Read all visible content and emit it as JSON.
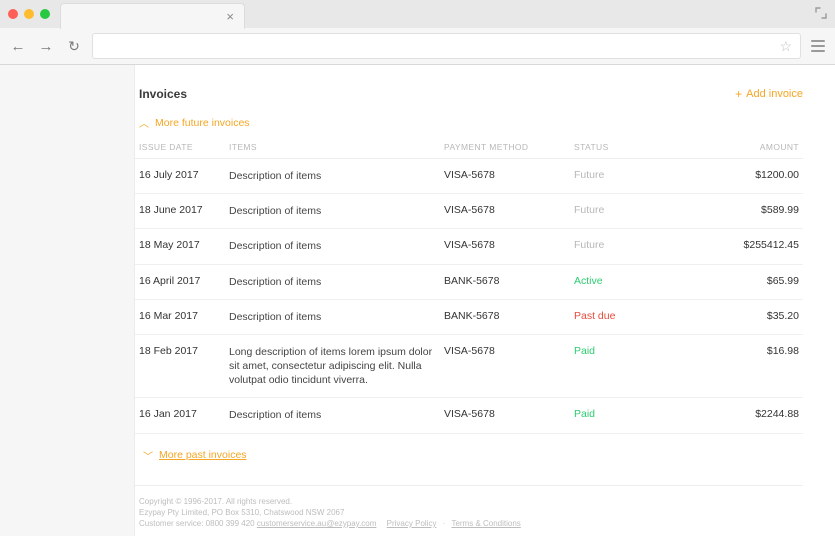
{
  "header": {
    "title": "Invoices",
    "add_label": "Add invoice",
    "more_future_label": "More future invoices",
    "more_past_label": "More past invoices"
  },
  "columns": {
    "issue_date": "ISSUE DATE",
    "items": "ITEMS",
    "payment_method": "PAYMENT METHOD",
    "status": "STATUS",
    "amount": "AMOUNT"
  },
  "rows": [
    {
      "date": "16 July 2017",
      "items": "Description of items",
      "payment": "VISA-5678",
      "status": "Future",
      "status_key": "future",
      "amount": "$1200.00"
    },
    {
      "date": "18 June 2017",
      "items": "Description of items",
      "payment": "VISA-5678",
      "status": "Future",
      "status_key": "future",
      "amount": "$589.99"
    },
    {
      "date": "18 May 2017",
      "items": "Description of items",
      "payment": "VISA-5678",
      "status": "Future",
      "status_key": "future",
      "amount": "$255412.45"
    },
    {
      "date": "16 April 2017",
      "items": "Description of items",
      "payment": "BANK-5678",
      "status": "Active",
      "status_key": "active",
      "amount": "$65.99"
    },
    {
      "date": "16 Mar 2017",
      "items": "Description of items",
      "payment": "BANK-5678",
      "status": "Past due",
      "status_key": "pastdue",
      "amount": "$35.20"
    },
    {
      "date": "18 Feb 2017",
      "items": "Long description of items lorem ipsum dolor sit amet, consectetur adipiscing elit. Nulla volutpat odio tincidunt viverra.",
      "payment": "VISA-5678",
      "status": "Paid",
      "status_key": "paid",
      "amount": "$16.98"
    },
    {
      "date": "16 Jan 2017",
      "items": "Description of items",
      "payment": "VISA-5678",
      "status": "Paid",
      "status_key": "paid",
      "amount": "$2244.88"
    }
  ],
  "footer": {
    "line1": "Copyright © 1996-2017. All rights reserved.",
    "line2": "Ezypay Pty Limited, PO Box 5310, Chatswood NSW 2067",
    "line3_prefix": "Customer service: 0800 399 420 ",
    "email": "customerservice.au@ezypay.com",
    "privacy": "Privacy Policy",
    "terms": "Terms & Conditions"
  }
}
